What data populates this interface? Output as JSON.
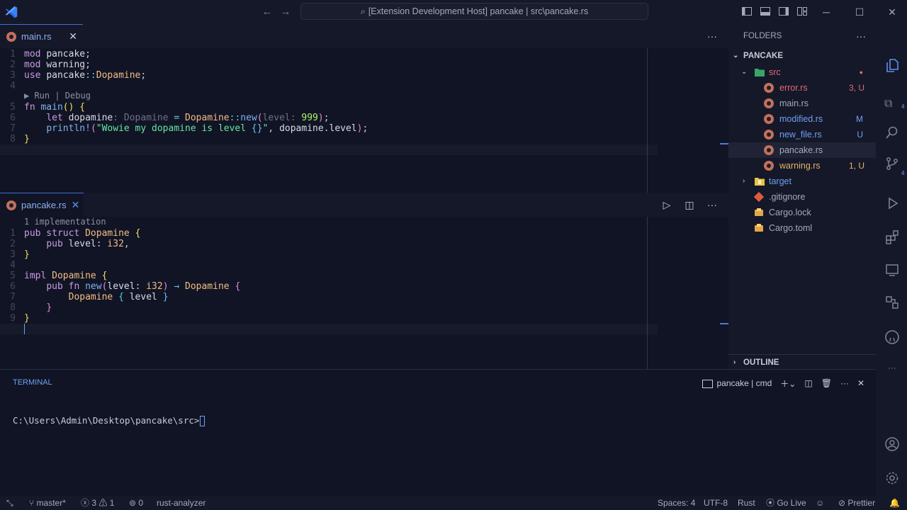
{
  "titlebar": {
    "command_center": "[Extension Development Host] pancake | src\\pancake.rs",
    "icons": [
      "vscode-logo-icon",
      "arrow-left-icon",
      "arrow-right-icon",
      "search-icon",
      "toggle-primary-sidebar-icon",
      "toggle-panel-icon",
      "toggle-secondary-sidebar-icon",
      "customize-layout-icon",
      "minimize-icon",
      "maximize-icon",
      "close-window-icon"
    ]
  },
  "editor1": {
    "tab_label": "main.rs",
    "codelens": "▶ Run | Debug",
    "line_numbers": [
      "1",
      "2",
      "3",
      "4",
      "5",
      "6",
      "7",
      "8"
    ]
  },
  "editor2": {
    "tab_label": "pancake.rs",
    "codelens": "1 implementation",
    "line_numbers": [
      "1",
      "2",
      "3",
      "4",
      "5",
      "6",
      "7",
      "8",
      "9"
    ]
  },
  "explorer": {
    "header": "FOLDERS",
    "root": "PANCAKE",
    "items": [
      {
        "name": "src",
        "badge": "●",
        "color": "#e0697a"
      },
      {
        "name": "error.rs",
        "badge": "3, U",
        "color": "#e0697a"
      },
      {
        "name": "main.rs",
        "badge": "",
        "color": "#a6a9ba"
      },
      {
        "name": "modified.rs",
        "badge": "M",
        "color": "#6fa0f4"
      },
      {
        "name": "new_file.rs",
        "badge": "U",
        "color": "#6fa0f4"
      },
      {
        "name": "pancake.rs",
        "badge": "",
        "color": "#a6a9ba"
      },
      {
        "name": "warning.rs",
        "badge": "1, U",
        "color": "#e6b266"
      },
      {
        "name": "target",
        "badge": "",
        "color": "#6fa0f4"
      },
      {
        "name": ".gitignore",
        "badge": "",
        "color": "#a6a9ba"
      },
      {
        "name": "Cargo.lock",
        "badge": "",
        "color": "#a6a9ba"
      },
      {
        "name": "Cargo.toml",
        "badge": "",
        "color": "#a6a9ba"
      }
    ],
    "outline": "OUTLINE"
  },
  "activitybar": {
    "explorer_badge": "4",
    "scm_badge": "4"
  },
  "terminal": {
    "title": "TERMINAL",
    "instance": "pancake | cmd",
    "prompt": "C:\\Users\\Admin\\Desktop\\pancake\\src>"
  },
  "statusbar": {
    "branch": "master*",
    "errors": "3",
    "warnings": "1",
    "ports": "0",
    "analyzer": "rust-analyzer",
    "spaces": "Spaces: 4",
    "encoding": "UTF-8",
    "language": "Rust",
    "golive": "Go Live",
    "prettier": "Prettier"
  },
  "colors": {
    "background": "#111424",
    "chrome": "#151828",
    "accent": "#6fa0f4"
  }
}
